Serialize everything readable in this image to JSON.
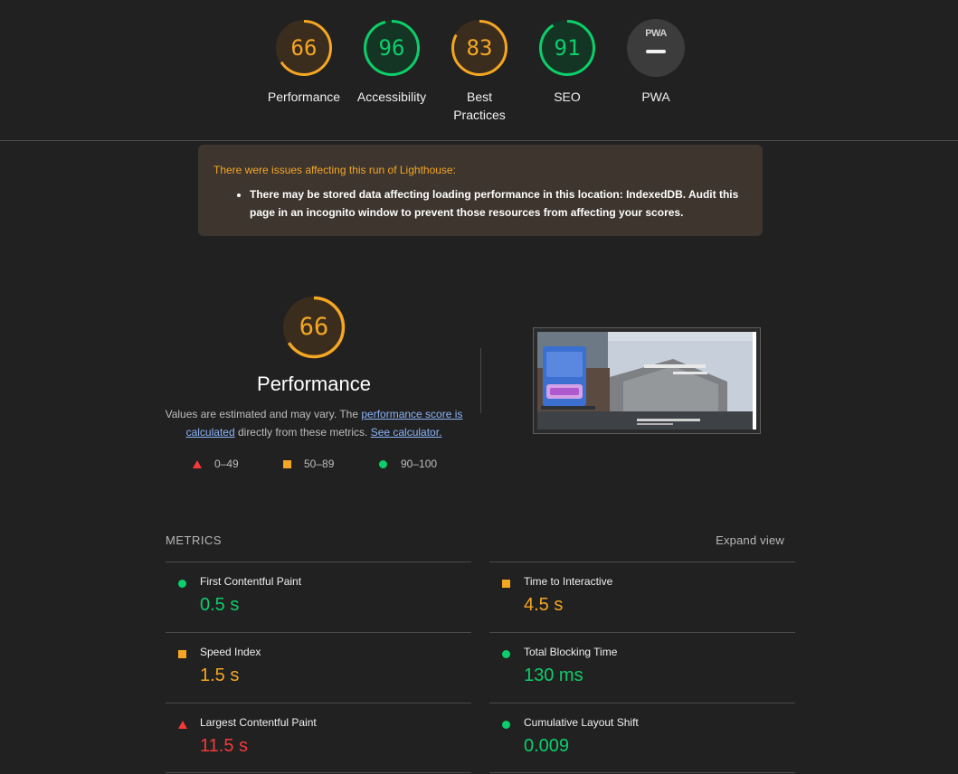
{
  "colors": {
    "pass": "#0cce6b",
    "average": "#f5a623",
    "fail": "#f33a3a",
    "background": "#212121"
  },
  "gauges": [
    {
      "score": "66",
      "label": "Performance",
      "rating": "average"
    },
    {
      "score": "96",
      "label": "Accessibility",
      "rating": "pass"
    },
    {
      "score": "83",
      "label": "Best Practices",
      "rating": "average"
    },
    {
      "score": "91",
      "label": "SEO",
      "rating": "pass"
    },
    {
      "badge": "PWA",
      "label": "PWA",
      "rating": "na"
    }
  ],
  "warning": {
    "title": "There were issues affecting this run of Lighthouse:",
    "items": [
      "There may be stored data affecting loading performance in this location: IndexedDB. Audit this page in an incognito window to prevent those resources from affecting your scores."
    ]
  },
  "performance": {
    "score": "66",
    "title": "Performance",
    "desc_before": "Values are estimated and may vary. The ",
    "desc_link1": "performance score is calculated",
    "desc_middle": " directly from these metrics. ",
    "desc_link2": "See calculator.",
    "legend": [
      {
        "shape": "triangle",
        "range": "0–49"
      },
      {
        "shape": "square",
        "range": "50–89"
      },
      {
        "shape": "circle",
        "range": "90–100"
      }
    ]
  },
  "metrics": {
    "heading": "METRICS",
    "expand_label": "Expand view",
    "items": [
      {
        "title": "First Contentful Paint",
        "value": "0.5 s",
        "rating": "pass"
      },
      {
        "title": "Time to Interactive",
        "value": "4.5 s",
        "rating": "average"
      },
      {
        "title": "Speed Index",
        "value": "1.5 s",
        "rating": "average"
      },
      {
        "title": "Total Blocking Time",
        "value": "130 ms",
        "rating": "pass"
      },
      {
        "title": "Largest Contentful Paint",
        "value": "11.5 s",
        "rating": "fail"
      },
      {
        "title": "Cumulative Layout Shift",
        "value": "0.009",
        "rating": "pass"
      }
    ]
  }
}
